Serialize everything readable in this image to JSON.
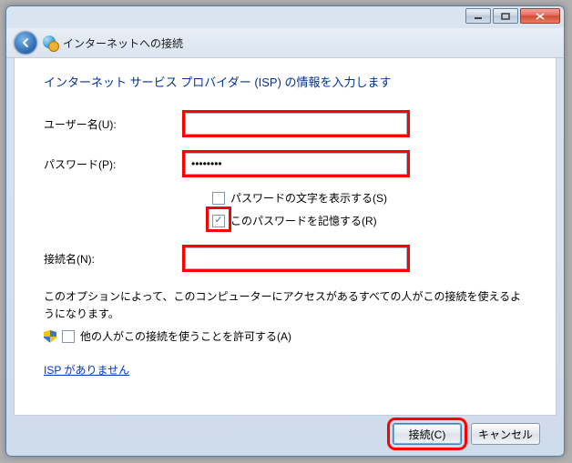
{
  "window": {
    "title": "インターネットへの接続"
  },
  "heading": "インターネット サービス プロバイダー (ISP) の情報を入力します",
  "fields": {
    "username_label": "ユーザー名(U):",
    "username_value": "",
    "password_label": "パスワード(P):",
    "password_value": "••••••••",
    "show_password_label": "パスワードの文字を表示する(S)",
    "show_password_checked": false,
    "remember_password_label": "このパスワードを記憶する(R)",
    "remember_password_checked": true,
    "connection_name_label": "接続名(N):",
    "connection_name_value": ""
  },
  "note": "このオプションによって、このコンピューターにアクセスがあるすべての人がこの接続を使えるようになります。",
  "allow_others_label": "他の人がこの接続を使うことを許可する(A)",
  "allow_others_checked": false,
  "link": "ISP がありません",
  "buttons": {
    "connect": "接続(C)",
    "cancel": "キャンセル"
  },
  "highlights": {
    "username": true,
    "password": true,
    "remember_checkbox": true,
    "connection_name": true,
    "connect_button": true
  }
}
